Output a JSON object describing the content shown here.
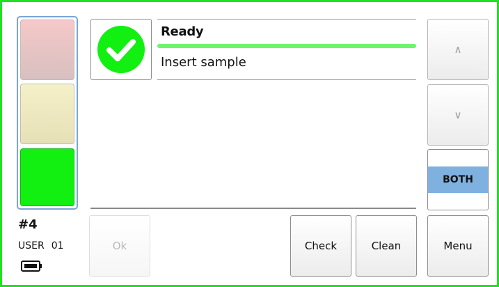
{
  "status": {
    "title": "Ready",
    "message": "Insert sample",
    "progress": 1.0,
    "icon": "check-circle-icon",
    "color": "#12f012"
  },
  "indicators": [
    "red",
    "yellow",
    "green"
  ],
  "device": {
    "unit": "#4",
    "user_label": "USER",
    "user_number": "01",
    "battery_icon": "battery-icon"
  },
  "buttons": {
    "up": "∧",
    "down": "∨",
    "both": "BOTH",
    "ok": "Ok",
    "check": "Check",
    "clean": "Clean",
    "menu": "Menu"
  }
}
